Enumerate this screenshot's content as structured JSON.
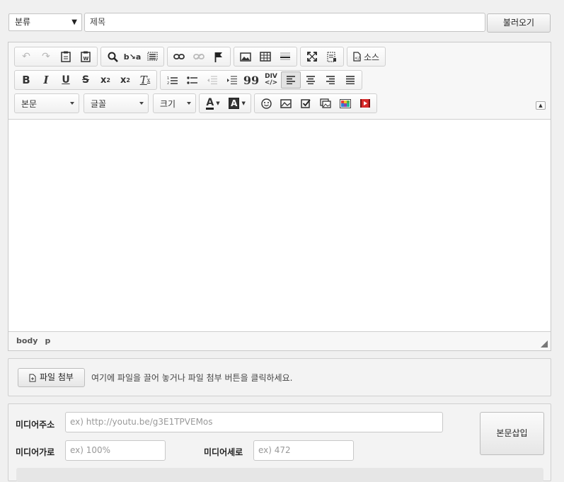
{
  "top": {
    "category_label": "분류",
    "title_placeholder": "제목",
    "load_button": "불러오기"
  },
  "toolbar": {
    "source_label": "소스",
    "format_label": "본문",
    "font_label": "글꼴",
    "size_label": "크기"
  },
  "path": {
    "body": "body",
    "p": "p"
  },
  "attach": {
    "button_label": "파일 첨부",
    "hint": "여기에 파일을 끌어 놓거나 파일 첨부 버튼을 클릭하세요."
  },
  "media": {
    "url_label": "미디어주소",
    "url_placeholder": "ex) http://youtu.be/g3E1TPVEMos",
    "width_label": "미디어가로",
    "width_placeholder": "ex) 100%",
    "height_label": "미디어세로",
    "height_placeholder": "ex) 472",
    "insert_button": "본문삽입"
  },
  "colors": {
    "background": "#f0f0f0",
    "border": "#c9c9c9"
  }
}
